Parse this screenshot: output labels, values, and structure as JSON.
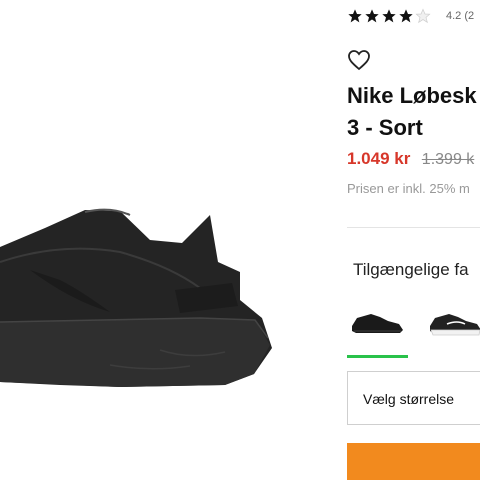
{
  "product": {
    "name_line1": "Nike Løbesk",
    "name_line2": "3 - Sort",
    "price": "1.049 kr",
    "old_price": "1.399 k",
    "vat_note": "Prisen er inkl. 25% m",
    "rating_value": 4.2,
    "rating_text": "4.2 (2",
    "image_icon": "black-running-shoe"
  },
  "colors": {
    "heading": "Tilgængelige fa",
    "swatches": [
      {
        "name": "black-shoe",
        "selected": true
      },
      {
        "name": "black-white-shoe",
        "selected": false
      }
    ]
  },
  "size_select": {
    "label": "Vælg størrelse"
  },
  "theme": {
    "price_color": "#d7372a",
    "accent_green": "#29c24a",
    "button_color": "#f28a1e"
  }
}
